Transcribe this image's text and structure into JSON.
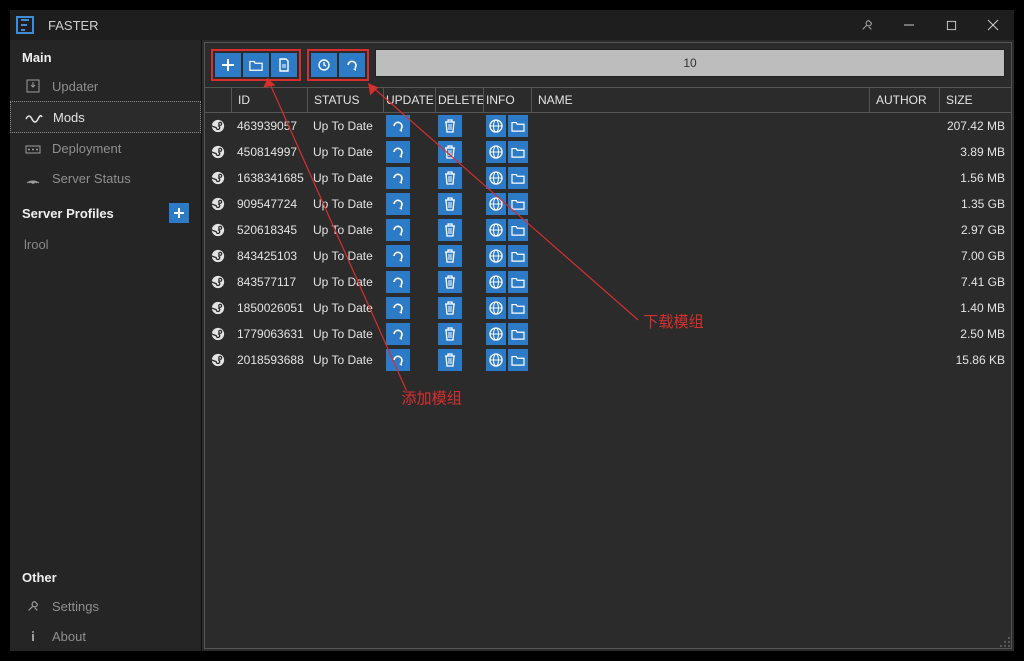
{
  "window": {
    "title": "FASTER"
  },
  "sidebar": {
    "main_label": "Main",
    "items": [
      {
        "label": "Updater",
        "icon": "download"
      },
      {
        "label": "Mods",
        "icon": "mods"
      },
      {
        "label": "Deployment",
        "icon": "deploy"
      },
      {
        "label": "Server Status",
        "icon": "signal"
      }
    ],
    "profiles_label": "Server Profiles",
    "profiles": [
      {
        "name": "lrool"
      }
    ],
    "other_label": "Other",
    "other_items": [
      {
        "label": "Settings",
        "icon": "wrench"
      },
      {
        "label": "About",
        "icon": "info"
      }
    ]
  },
  "toolbar": {
    "search_value": "10"
  },
  "table": {
    "columns": {
      "id": "ID",
      "status": "STATUS",
      "update": "UPDATE",
      "delete": "DELETE",
      "info": "INFO",
      "name": "NAME",
      "author": "AUTHOR",
      "size": "SIZE"
    },
    "rows": [
      {
        "id": "463939057",
        "status": "Up To Date",
        "size": "207.42 MB"
      },
      {
        "id": "450814997",
        "status": "Up To Date",
        "size": "3.89 MB"
      },
      {
        "id": "1638341685",
        "status": "Up To Date",
        "size": "1.56 MB"
      },
      {
        "id": "909547724",
        "status": "Up To Date",
        "size": "1.35 GB"
      },
      {
        "id": "520618345",
        "status": "Up To Date",
        "size": "2.97 GB"
      },
      {
        "id": "843425103",
        "status": "Up To Date",
        "size": "7.00 GB"
      },
      {
        "id": "843577117",
        "status": "Up To Date",
        "size": "7.41 GB"
      },
      {
        "id": "1850026051",
        "status": "Up To Date",
        "size": "1.40 MB"
      },
      {
        "id": "1779063631",
        "status": "Up To Date",
        "size": "2.50 MB"
      },
      {
        "id": "2018593688",
        "status": "Up To Date",
        "size": "15.86 KB"
      }
    ]
  },
  "annotations": {
    "add": "添加模组",
    "download": "下载模组"
  },
  "colors": {
    "accent": "#2d7ac7",
    "danger": "#d82e2e"
  }
}
